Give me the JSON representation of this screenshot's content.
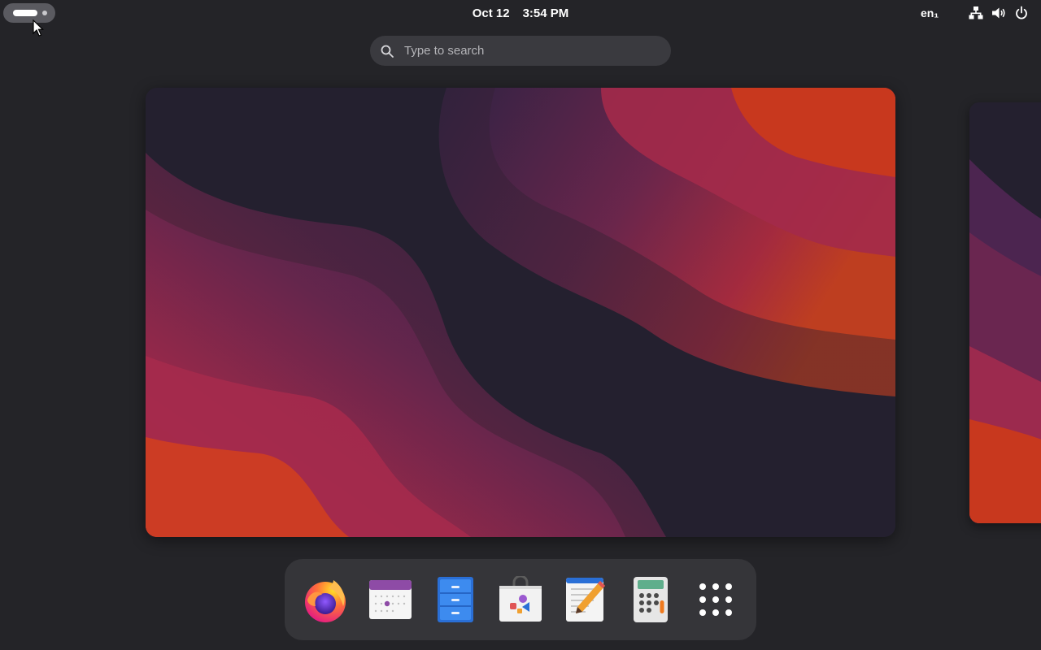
{
  "topbar": {
    "date": "Oct 12",
    "time": "3:54 PM",
    "input_source": "en₁",
    "icons": [
      "network-icon",
      "volume-icon",
      "power-icon"
    ]
  },
  "search": {
    "placeholder": "Type to search"
  },
  "dock": {
    "apps": [
      "firefox-icon",
      "calendar-icon",
      "files-icon",
      "software-store-icon",
      "text-editor-icon",
      "calculator-icon",
      "app-grid-icon"
    ]
  },
  "colors": {
    "background": "#242428",
    "wallpaper_dark": "#24202f",
    "wallpaper_purple": "#5a2850",
    "wallpaper_red": "#a82a4a",
    "wallpaper_orange": "#d2421e"
  }
}
